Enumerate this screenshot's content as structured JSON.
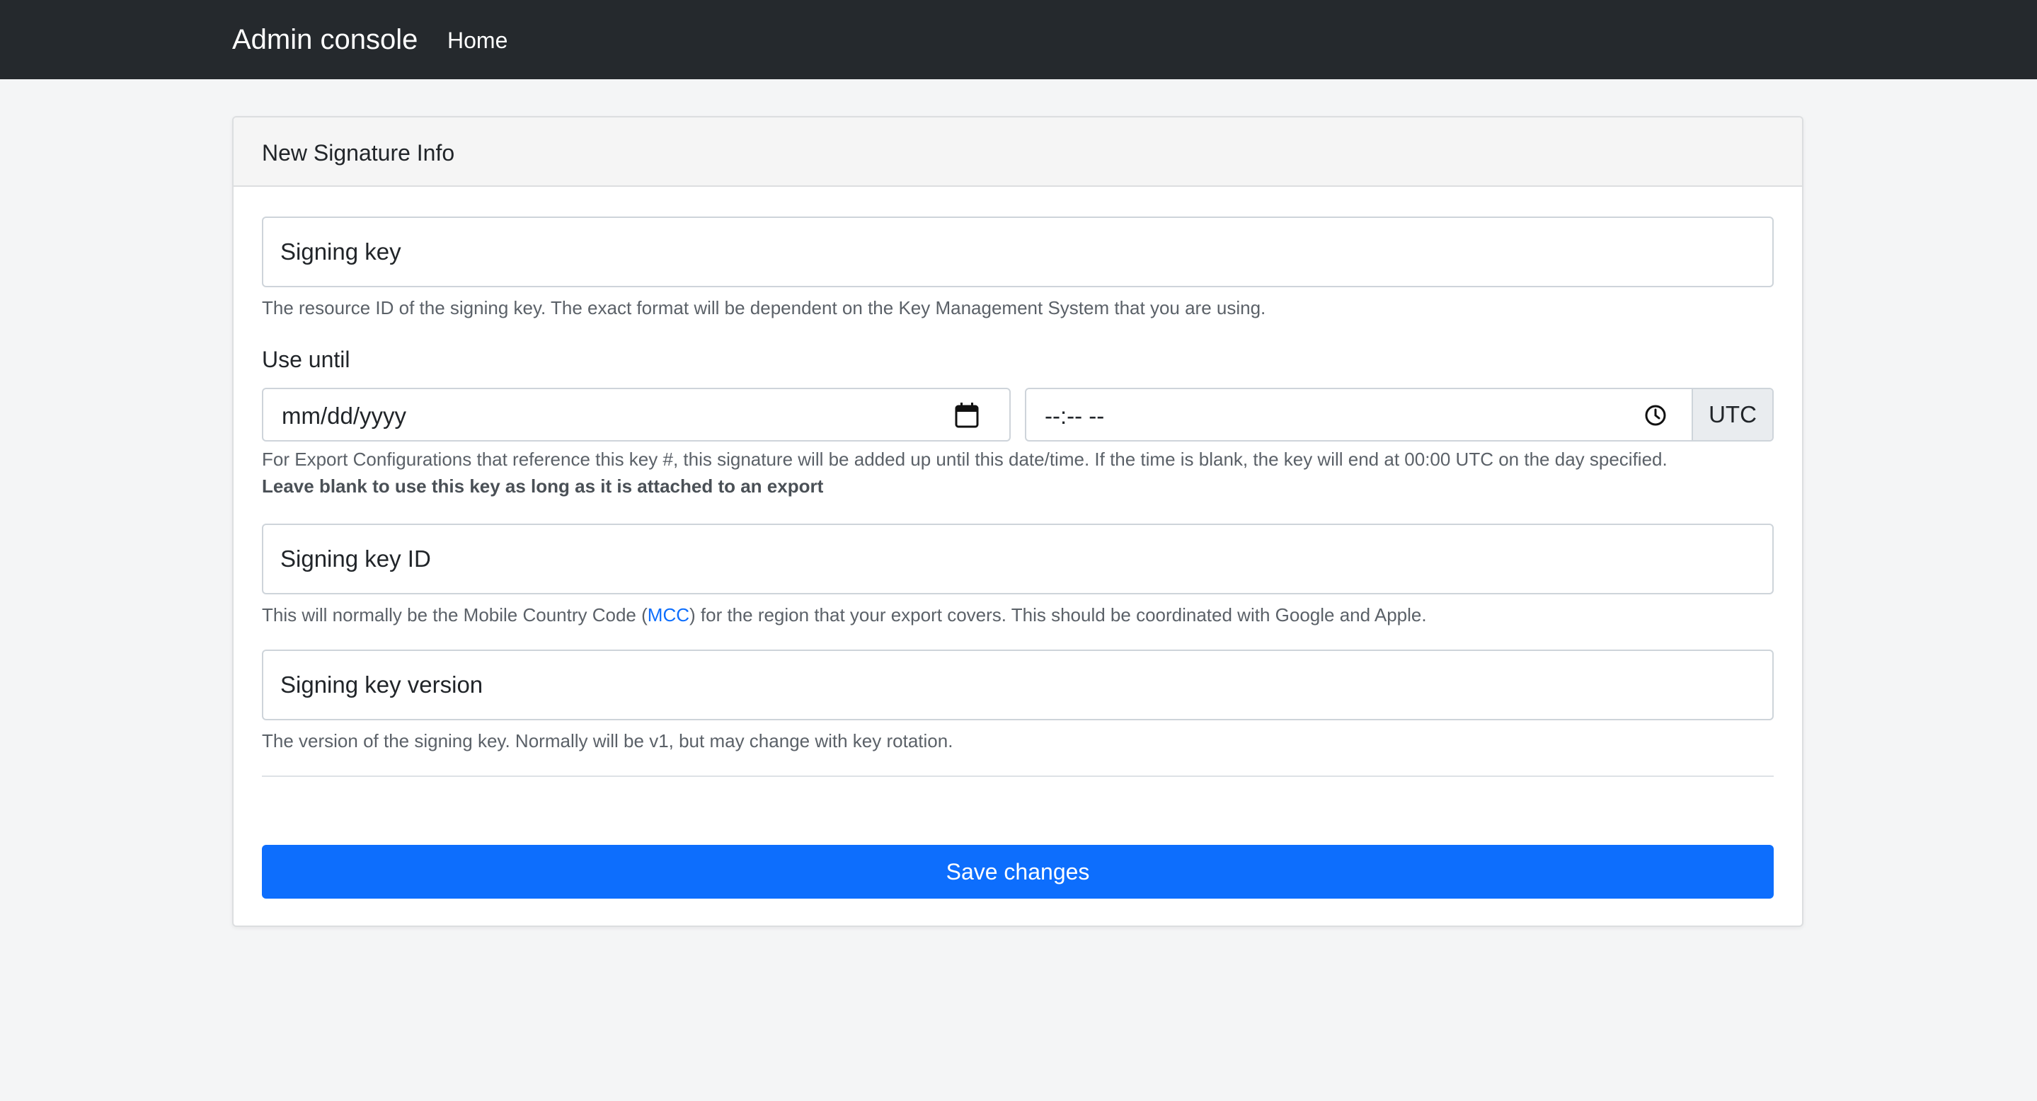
{
  "navbar": {
    "brand": "Admin console",
    "home_link": "Home"
  },
  "card": {
    "title": "New Signature Info"
  },
  "signing_key": {
    "placeholder": "Signing key",
    "help": "The resource ID of the signing key. The exact format will be dependent on the Key Management System that you are using."
  },
  "use_until": {
    "label": "Use until",
    "date_placeholder": "mm/dd/yyyy",
    "time_placeholder": "--:-- --",
    "timezone": "UTC",
    "help": "For Export Configurations that reference this key #, this signature will be added up until this date/time. If the time is blank, the key will end at 00:00 UTC on the day specified.",
    "help_strong": "Leave blank to use this key as long as it is attached to an export"
  },
  "signing_key_id": {
    "placeholder": "Signing key ID",
    "help_before": "This will normally be the Mobile Country Code (",
    "help_link": "MCC",
    "help_after": ") for the region that your export covers. This should be coordinated with Google and Apple."
  },
  "signing_key_version": {
    "placeholder": "Signing key version",
    "help": "The version of the signing key. Normally will be v1, but may change with key rotation."
  },
  "save_button": "Save changes",
  "colors": {
    "navbar": "#25292d",
    "primary": "#0d6efd",
    "background": "#f4f5f6"
  }
}
